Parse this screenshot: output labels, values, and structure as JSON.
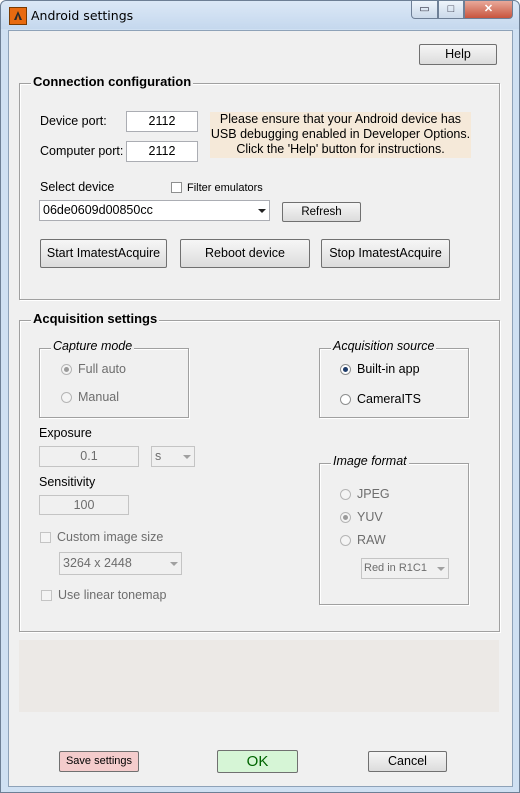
{
  "window": {
    "title": "Android settings",
    "min_glyph": "▭",
    "max_glyph": "□",
    "close_glyph": "✕"
  },
  "help_label": "Help",
  "connection": {
    "title": "Connection configuration",
    "device_port_label": "Device port:",
    "device_port": "2112",
    "computer_port_label": "Computer port:",
    "computer_port": "2112",
    "notice_lines": [
      "Please ensure that your Android device has",
      "USB debugging enabled in Developer Options.",
      "Click the 'Help' button for instructions."
    ],
    "select_device_label": "Select device",
    "filter_emulators_label": "Filter emulators",
    "device_value": "06de0609d00850cc",
    "refresh_label": "Refresh",
    "start_label": "Start ImatestAcquire",
    "reboot_label": "Reboot device",
    "stop_label": "Stop ImatestAcquire"
  },
  "acquisition": {
    "title": "Acquisition settings",
    "capture_mode": {
      "title": "Capture mode",
      "options": [
        "Full auto",
        "Manual"
      ],
      "selected": "Full auto"
    },
    "exposure_label": "Exposure",
    "exposure_value": "0.1",
    "exposure_unit": "s",
    "sensitivity_label": "Sensitivity",
    "sensitivity_value": "100",
    "custom_size_label": "Custom image size",
    "image_size": "3264 x 2448",
    "linear_tonemap_label": "Use linear tonemap",
    "source": {
      "title": "Acquisition source",
      "options": [
        "Built-in app",
        "CameraITS"
      ],
      "selected": "Built-in app"
    },
    "format": {
      "title": "Image format",
      "options": [
        "JPEG",
        "YUV",
        "RAW"
      ],
      "selected": "YUV",
      "raw_channel": "Red in R1C1"
    }
  },
  "footer": {
    "save_label": "Save settings",
    "ok_label": "OK",
    "cancel_label": "Cancel"
  },
  "colors": {
    "notice_bg": "#f5e9d9",
    "save_bg": "#f4cccc",
    "ok_bg": "#d6f5d6",
    "ok_text": "#006400"
  }
}
